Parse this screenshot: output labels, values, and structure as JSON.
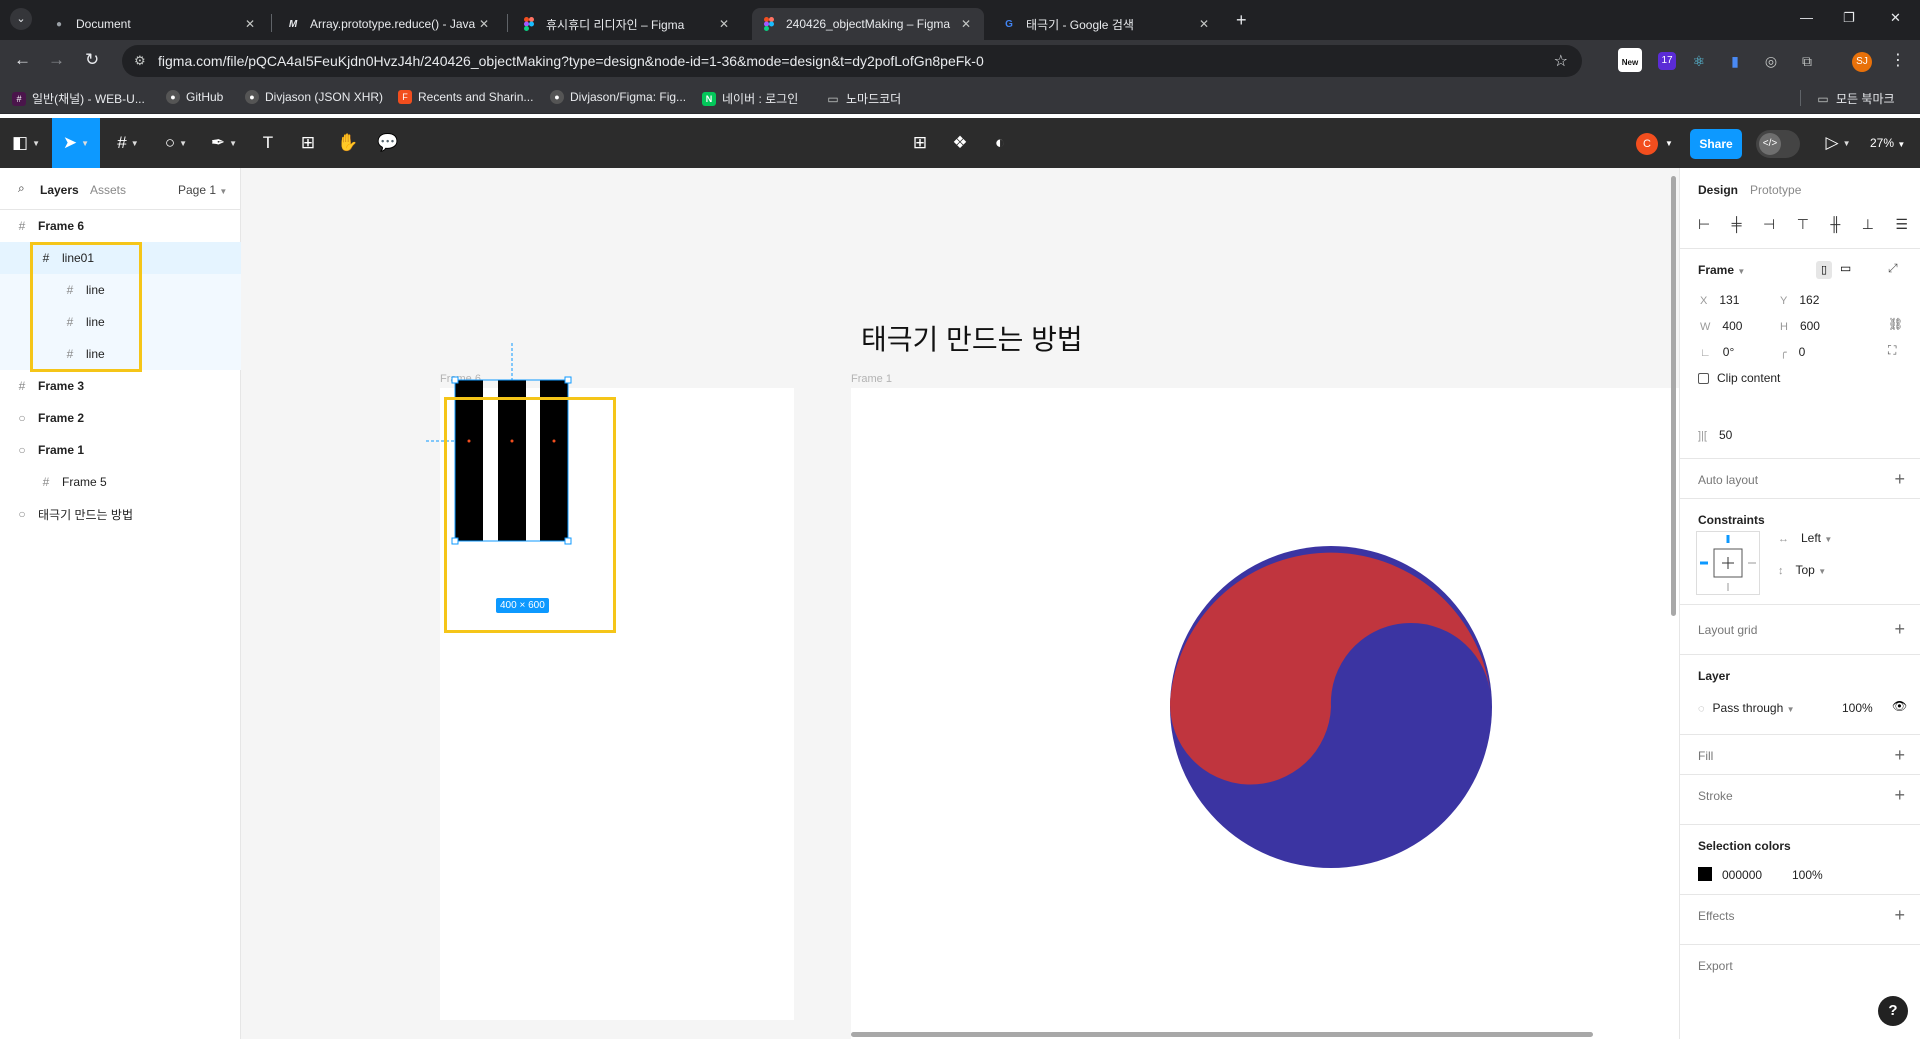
{
  "browser": {
    "tabs": [
      {
        "title": "Document"
      },
      {
        "title": "Array.prototype.reduce() - Java"
      },
      {
        "title": "휴시휴디 리디자인 – Figma"
      },
      {
        "title": "240426_objectMaking – Figma"
      },
      {
        "title": "태극기 - Google 검색"
      }
    ],
    "url": "figma.com/file/pQCA4aI5FeuKjdn0HvzJ4h/240426_objectMaking?type=design&node-id=1-36&mode=design&t=dy2pofLofGn8peFk-0",
    "ext_new_label": "New",
    "ext_badge": "17",
    "profile": "SJ",
    "bookmarks": [
      {
        "label": "일반(채널) - WEB-U..."
      },
      {
        "label": "GitHub"
      },
      {
        "label": "Divjason (JSON XHR)"
      },
      {
        "label": "Recents and Sharin..."
      },
      {
        "label": "Divjason/Figma: Fig..."
      },
      {
        "label": "네이버 : 로그인"
      },
      {
        "label": "노마드코더"
      }
    ],
    "all_bookmarks": "모든 북마크"
  },
  "figma": {
    "share_label": "Share",
    "collaborator_initial": "C",
    "zoom": "27%",
    "left_panel": {
      "tab_layers": "Layers",
      "tab_assets": "Assets",
      "page": "Page 1",
      "layers": [
        {
          "name": "Frame 6"
        },
        {
          "name": "line01"
        },
        {
          "name": "line"
        },
        {
          "name": "line"
        },
        {
          "name": "line"
        },
        {
          "name": "Frame 3"
        },
        {
          "name": "Frame 2"
        },
        {
          "name": "Frame 1"
        },
        {
          "name": "Frame 5"
        },
        {
          "name": "태극기 만드는 방법"
        }
      ]
    },
    "canvas": {
      "title": "태극기 만드는 방법",
      "frame6_label": "Frame 6",
      "frame1_label": "Frame 1",
      "size_badge": "400 × 600",
      "colors": {
        "red": "#c0353e",
        "blue": "#3b34a2",
        "selection": "#0d99ff",
        "highlight": "#f5c518"
      }
    },
    "right_panel": {
      "tab_design": "Design",
      "tab_prototype": "Prototype",
      "frame_label": "Frame",
      "x_label": "X",
      "x": "131",
      "y_label": "Y",
      "y": "162",
      "w_label": "W",
      "w": "400",
      "h_label": "H",
      "h": "600",
      "rotation": "0°",
      "radius": "0",
      "clip_content": "Clip content",
      "spacing": "50",
      "auto_layout": "Auto layout",
      "constraints": "Constraints",
      "constraint_h": "Left",
      "constraint_v": "Top",
      "layout_grid": "Layout grid",
      "layer": "Layer",
      "blend": "Pass through",
      "opacity": "100%",
      "fill": "Fill",
      "stroke": "Stroke",
      "selection_colors": "Selection colors",
      "sel_color_hex": "000000",
      "sel_color_opacity": "100%",
      "effects": "Effects",
      "export": "Export"
    }
  }
}
